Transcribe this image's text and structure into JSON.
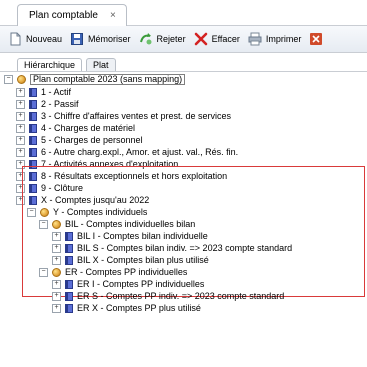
{
  "window": {
    "tab_title": "Plan comptable",
    "tab_close": "×"
  },
  "toolbar": {
    "buttons": [
      {
        "label": "Nouveau",
        "icon": "new-document-icon"
      },
      {
        "label": "Mémoriser",
        "icon": "save-icon"
      },
      {
        "label": "Rejeter",
        "icon": "reject-icon"
      },
      {
        "label": "Effacer",
        "icon": "delete-icon"
      },
      {
        "label": "Imprimer",
        "icon": "print-icon"
      }
    ]
  },
  "view_tabs": [
    {
      "label": "Hiérarchique",
      "active": true
    },
    {
      "label": "Plat",
      "active": false
    }
  ],
  "tree": {
    "root": "Plan comptable 2023 (sans mapping)",
    "items": [
      {
        "label": "1 - Actif",
        "expander": "+"
      },
      {
        "label": "2 - Passif",
        "expander": "+"
      },
      {
        "label": "3 - Chiffre d'affaires ventes et prest. de services",
        "expander": "+"
      },
      {
        "label": "4 - Charges de matériel",
        "expander": "+"
      },
      {
        "label": "5 - Charges de personnel",
        "expander": "+"
      },
      {
        "label": "6 - Autre charg.expl., Amor. et ajust. val., Rés. fin.",
        "expander": "+"
      },
      {
        "label": "7 - Activités annexes d'exploitation",
        "expander": "+"
      },
      {
        "label": "8 - Résultats exceptionnels et hors exploitation",
        "expander": "+"
      },
      {
        "label": "9 - Clôture",
        "expander": "+"
      },
      {
        "label": "X - Comptes jusqu'au 2022",
        "expander": "+"
      }
    ],
    "individual": {
      "label": "Y - Comptes individuels",
      "expander": "−",
      "groups": [
        {
          "label": "BIL - Comptes individuelles bilan",
          "expander": "−",
          "children": [
            {
              "label": "BIL I - Comptes bilan individuelle",
              "expander": "+"
            },
            {
              "label": "BIL S - Comptes bilan indiv. => 2023 compte standard",
              "expander": "+"
            },
            {
              "label": "BIL X - Comptes bilan plus utilisé",
              "expander": "+"
            }
          ]
        },
        {
          "label": "ER - Comptes PP individuelles",
          "expander": "−",
          "children": [
            {
              "label": "ER I - Comptes PP individuelles",
              "expander": "+"
            },
            {
              "label": "ER S - Comptes PP indiv. => 2023 compte standard",
              "expander": "+"
            },
            {
              "label": "ER X - Comptes PP plus utilisé",
              "expander": "+"
            }
          ]
        }
      ]
    }
  },
  "colors": {
    "highlight": "#d93a3a",
    "book": "#4a5cc8",
    "globe": "#e3a43a"
  }
}
